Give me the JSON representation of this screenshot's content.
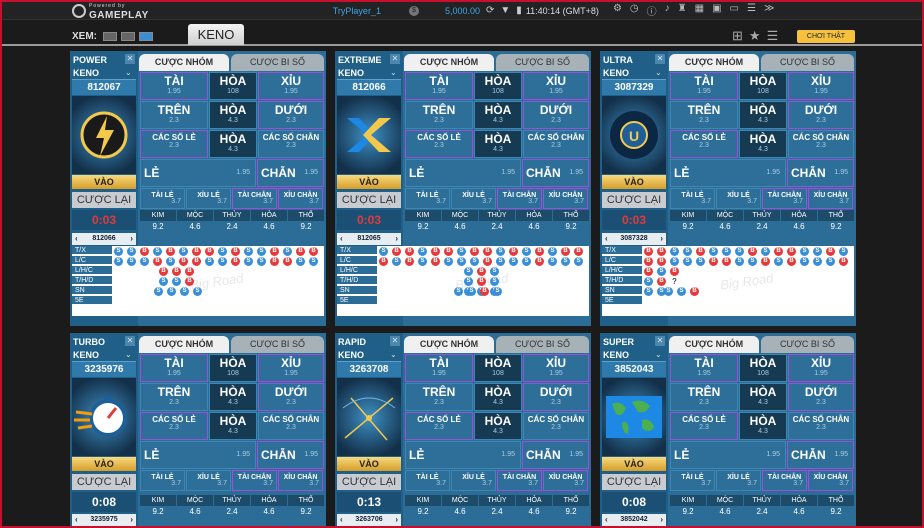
{
  "topbar": {
    "powered_by": "Powered by",
    "logo_text": "GAMEPLAY",
    "player": "TryPlayer_1",
    "balance": "5,000.00",
    "clock": "11:40:14 (GMT+8)"
  },
  "subbar": {
    "view_label": "XEM:",
    "tab": "KENO",
    "real_play": "CHƠI THẬT"
  },
  "bet_tabs": {
    "main": "CƯỢC NHÓM",
    "other": "CƯỢC BI SỐ"
  },
  "labels": {
    "tai": "TÀI",
    "hoa": "HÒA",
    "xiu": "XỈU",
    "tren": "TRÊN",
    "duoi": "DƯỚI",
    "cac_so_le": "CÁC SỐ LẺ",
    "cac_so_chan": "CÁC SỐ CHẴN",
    "le": "LẺ",
    "chan": "CHẴN",
    "tai_le": "TÀI LẺ",
    "xiu_le": "XỈU LẺ",
    "tai_chan": "TÀI CHẴN",
    "xiu_chan": "XỈU CHẴN",
    "vao": "VÀO",
    "cuoc_lai": "CƯỢC LẠI",
    "elements": [
      "KIM",
      "MỘC",
      "THỦY",
      "HỎA",
      "THỔ"
    ]
  },
  "odds": {
    "tai": "1.95",
    "hoa_top": "108",
    "xiu": "1.95",
    "tren": "2.3",
    "hoa_mid": "4.3",
    "duoi": "2.3",
    "cac_so_le": "2.3",
    "cac_so_chan": "2.3",
    "le": "1.95",
    "chan": "1.95",
    "combo": "3.7",
    "elements": [
      "9.2",
      "4.6",
      "2.4",
      "4.6",
      "9.2"
    ]
  },
  "roads": {
    "labels": [
      "T/X",
      "L/C",
      "L/H/C",
      "T/H/D",
      "SN",
      "5E"
    ],
    "watermark": "Big Road"
  },
  "games": [
    {
      "name": "POWER KENO",
      "round": "812067",
      "timer": "0:03",
      "timer_red": true,
      "prev": "812066",
      "art": "power",
      "road": "r1"
    },
    {
      "name": "EXTREME KENO",
      "round": "812066",
      "timer": "0:03",
      "timer_red": true,
      "prev": "812065",
      "art": "extreme",
      "road": "r2"
    },
    {
      "name": "ULTRA KENO",
      "round": "3087329",
      "timer": "0:03",
      "timer_red": true,
      "prev": "3087328",
      "art": "ultra",
      "road": "r3"
    },
    {
      "name": "TURBO KENO",
      "round": "3235976",
      "timer": "0:08",
      "timer_red": false,
      "prev": "3235975",
      "art": "turbo",
      "road": ""
    },
    {
      "name": "RAPID KENO",
      "round": "3263708",
      "timer": "0:13",
      "timer_red": false,
      "prev": "3263706",
      "art": "rapid",
      "road": ""
    },
    {
      "name": "SUPER KENO",
      "round": "3852043",
      "timer": "0:08",
      "timer_red": false,
      "prev": "3852042",
      "art": "super",
      "road": ""
    }
  ],
  "road_data": {
    "r1": [
      [
        "S",
        "S",
        "B",
        "S",
        "B",
        "S",
        "B",
        "B",
        "S",
        "B",
        "S",
        "S",
        "B",
        "S",
        "B",
        "B"
      ],
      [
        "S",
        "S",
        "S",
        "B",
        "S",
        "B",
        "B",
        "S",
        "S",
        "B",
        "S",
        "S",
        "B",
        "B",
        "S",
        "S"
      ],
      [
        "B",
        "B",
        "B",
        "S",
        "S",
        "B"
      ],
      [
        "S",
        "S",
        "S",
        "S"
      ]
    ],
    "r2": [
      [
        "S",
        "B",
        "B",
        "S",
        "B",
        "B",
        "S",
        "B",
        "B",
        "S",
        "B",
        "S",
        "B",
        "S",
        "B",
        "B"
      ],
      [
        "B",
        "S",
        "B",
        "S",
        "B",
        "S",
        "S",
        "S",
        "B",
        "S",
        "S",
        "S",
        "B",
        "S",
        "S",
        "S"
      ],
      [
        "S",
        "B",
        "S",
        "S",
        "B",
        "S",
        "S",
        "S",
        "S"
      ],
      [
        "S",
        "S",
        "B",
        "S"
      ]
    ],
    "r3": [
      [
        "B",
        "B",
        "S",
        "S",
        "B",
        "S",
        "S",
        "S",
        "B",
        "S",
        "B",
        "B",
        "S",
        "S",
        "B",
        "S"
      ],
      [
        "B",
        "B",
        "S",
        "S",
        "S",
        "B",
        "B",
        "S",
        "S",
        "B",
        "S",
        "B",
        "S",
        "S",
        "S",
        "B"
      ],
      [
        "B",
        "S",
        "B",
        "S",
        "B",
        "?",
        "S",
        "S"
      ],
      [
        "S",
        "S",
        "B"
      ]
    ]
  }
}
